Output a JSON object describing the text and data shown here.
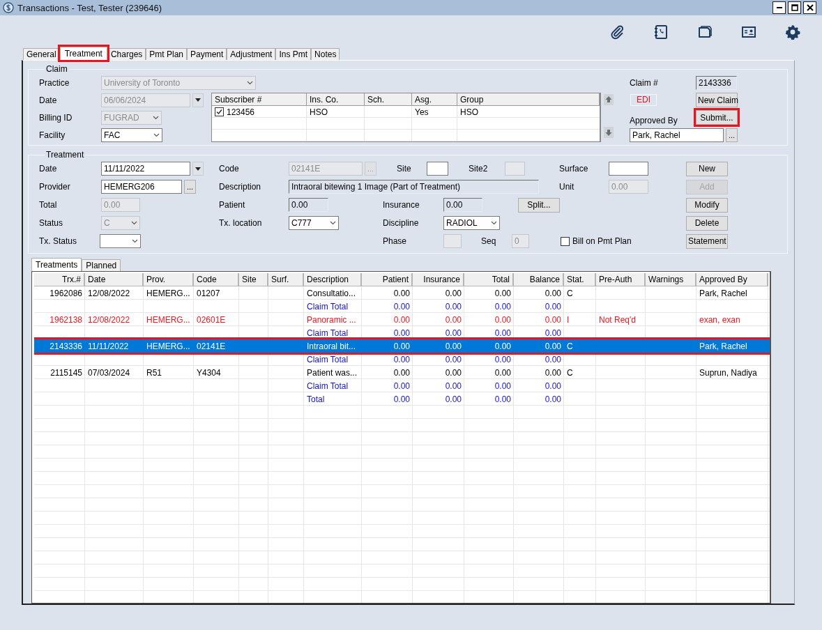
{
  "window": {
    "title": "Transactions - Test, Tester (239646)"
  },
  "tabs": [
    {
      "label": "General",
      "selected": false,
      "highlighted": false
    },
    {
      "label": "Treatment",
      "selected": true,
      "highlighted": true
    },
    {
      "label": "Charges",
      "selected": false,
      "highlighted": false
    },
    {
      "label": "Pmt Plan",
      "selected": false,
      "highlighted": false
    },
    {
      "label": "Payment",
      "selected": false,
      "highlighted": false
    },
    {
      "label": "Adjustment",
      "selected": false,
      "highlighted": false
    },
    {
      "label": "Ins Pmt",
      "selected": false,
      "highlighted": false
    },
    {
      "label": "Notes",
      "selected": false,
      "highlighted": false
    }
  ],
  "claim": {
    "group_label": "Claim",
    "practice": {
      "label": "Practice",
      "value": "University of Toronto",
      "kind": "combo",
      "disabled": true
    },
    "date": {
      "label": "Date",
      "value": "06/06/2024",
      "kind": "date",
      "disabled": true
    },
    "billing_id": {
      "label": "Billing ID",
      "value": "FUGRAD",
      "kind": "combo",
      "disabled": true
    },
    "facility": {
      "label": "Facility",
      "value": "FAC",
      "kind": "combo",
      "disabled": false
    },
    "subscribers": {
      "columns": [
        "Subscriber #",
        "Ins. Co.",
        "Sch.",
        "Asg.",
        "Group"
      ],
      "rows": [
        {
          "checked": true,
          "subscriber": "123456",
          "ins_co": "HSO",
          "asg": "Yes",
          "group": "HSO"
        }
      ]
    },
    "claim_number": {
      "label": "Claim #",
      "value": "2143336",
      "kind": "readonly",
      "disabled": false
    },
    "edi": "EDI",
    "new_claim": {
      "label": "New Claim",
      "disabled": false,
      "highlighted": false
    },
    "approved_by": {
      "label": "Approved By",
      "value": "Park, Rachel",
      "kind": "browse",
      "disabled": false,
      "button": "..."
    },
    "submit": {
      "label": "Submit...",
      "disabled": false,
      "highlighted": true
    }
  },
  "treatment": {
    "group_label": "Treatment",
    "date": {
      "label": "Date",
      "value": "11/11/2022",
      "kind": "date",
      "disabled": false
    },
    "provider": {
      "label": "Provider",
      "value": "HEMERG206",
      "kind": "browse",
      "disabled": false,
      "button": "..."
    },
    "total": {
      "label": "Total",
      "value": "0.00",
      "kind": "text",
      "disabled": true
    },
    "status": {
      "label": "Status",
      "value": "C",
      "kind": "combo",
      "disabled": true
    },
    "tx_status": {
      "label": "Tx. Status",
      "kind": "combo",
      "disabled": false
    },
    "code": {
      "label": "Code",
      "value": "02141E",
      "kind": "browse",
      "disabled": true,
      "button": "..."
    },
    "description": {
      "label": "Description",
      "value": "Intraoral bitewing 1 Image (Part of Treatment)",
      "kind": "readonly",
      "disabled": false
    },
    "patient": {
      "label": "Patient",
      "value": "0.00",
      "kind": "readonly",
      "disabled": false
    },
    "tx_location": {
      "label": "Tx. location",
      "value": "C777",
      "kind": "combo",
      "disabled": false
    },
    "site": {
      "label": "Site",
      "kind": "text",
      "disabled": false
    },
    "site2": {
      "label": "Site2",
      "kind": "text",
      "disabled": true
    },
    "insurance": {
      "label": "Insurance",
      "value": "0.00",
      "kind": "readonly",
      "disabled": false
    },
    "split": {
      "label": "Split...",
      "disabled": false
    },
    "discipline": {
      "label": "Discipline",
      "value": "RADIOL",
      "kind": "combo",
      "disabled": false
    },
    "phase": {
      "label": "Phase",
      "kind": "text",
      "disabled": true
    },
    "seq": {
      "label": "Seq",
      "value": "0",
      "kind": "text",
      "disabled": true
    },
    "surface": {
      "label": "Surface",
      "kind": "text",
      "disabled": false
    },
    "unit": {
      "label": "Unit",
      "value": "0.00",
      "kind": "text",
      "disabled": true
    },
    "bill_on_pmt_plan": {
      "label": "Bill on Pmt Plan",
      "checked": false
    },
    "buttons": [
      {
        "label": "New",
        "disabled": false
      },
      {
        "label": "Add",
        "disabled": true
      },
      {
        "label": "Modify",
        "disabled": false
      },
      {
        "label": "Delete",
        "disabled": false
      },
      {
        "label": "Statement",
        "disabled": false
      }
    ]
  },
  "subtabs": [
    {
      "label": "Treatments",
      "selected": true
    },
    {
      "label": "Planned",
      "selected": false
    }
  ],
  "grid": {
    "columns": [
      "Trx.#",
      "Date",
      "Prov.",
      "Code",
      "Site",
      "Surf.",
      "Description",
      "Patient",
      "Insurance",
      "Total",
      "Balance",
      "Stat.",
      "Pre-Auth",
      "Warnings",
      "Approved By"
    ],
    "rows": [
      {
        "kind": "item",
        "selected": false,
        "highlighted": false,
        "trx": "1962086",
        "date": "12/08/2022",
        "prov": "HEMERG...",
        "code": "01207",
        "description": "Consultatio...",
        "patient": "0.00",
        "insurance": "0.00",
        "total": "0.00",
        "balance": "0.00",
        "stat": "C",
        "approved_by": "Park, Rachel"
      },
      {
        "kind": "total",
        "description": "Claim Total",
        "patient": "0.00",
        "insurance": "0.00",
        "total": "0.00",
        "balance": "0.00"
      },
      {
        "kind": "alert",
        "selected": false,
        "highlighted": false,
        "trx": "1962138",
        "date": "12/08/2022",
        "prov": "HEMERG...",
        "code": "02601E",
        "description": "Panoramic ...",
        "patient": "0.00",
        "insurance": "0.00",
        "total": "0.00",
        "balance": "0.00",
        "stat": "I",
        "pre_auth": "Not Req'd",
        "approved_by": "exan, exan"
      },
      {
        "kind": "total",
        "description": "Claim Total",
        "patient": "0.00",
        "insurance": "0.00",
        "total": "0.00",
        "balance": "0.00"
      },
      {
        "kind": "item",
        "selected": true,
        "highlighted": true,
        "trx": "2143336",
        "date": "11/11/2022",
        "prov": "HEMERG...",
        "code": "02141E",
        "description": "Intraoral bit...",
        "patient": "0.00",
        "insurance": "0.00",
        "total": "0.00",
        "balance": "0.00",
        "stat": "C",
        "approved_by": "Park, Rachel"
      },
      {
        "kind": "total",
        "description": "Claim Total",
        "patient": "0.00",
        "insurance": "0.00",
        "total": "0.00",
        "balance": "0.00"
      },
      {
        "kind": "item",
        "selected": false,
        "highlighted": false,
        "trx": "2115145",
        "date": "07/03/2024",
        "prov": "R51",
        "code": "Y4304",
        "description": "Patient was...",
        "patient": "0.00",
        "insurance": "0.00",
        "total": "0.00",
        "balance": "0.00",
        "stat": "C",
        "approved_by": "Suprun, Nadiya"
      },
      {
        "kind": "total",
        "description": "Claim Total",
        "patient": "0.00",
        "insurance": "0.00",
        "total": "0.00",
        "balance": "0.00"
      },
      {
        "kind": "total",
        "description": "Total",
        "patient": "0.00",
        "insurance": "0.00",
        "total": "0.00",
        "balance": "0.00"
      }
    ]
  }
}
